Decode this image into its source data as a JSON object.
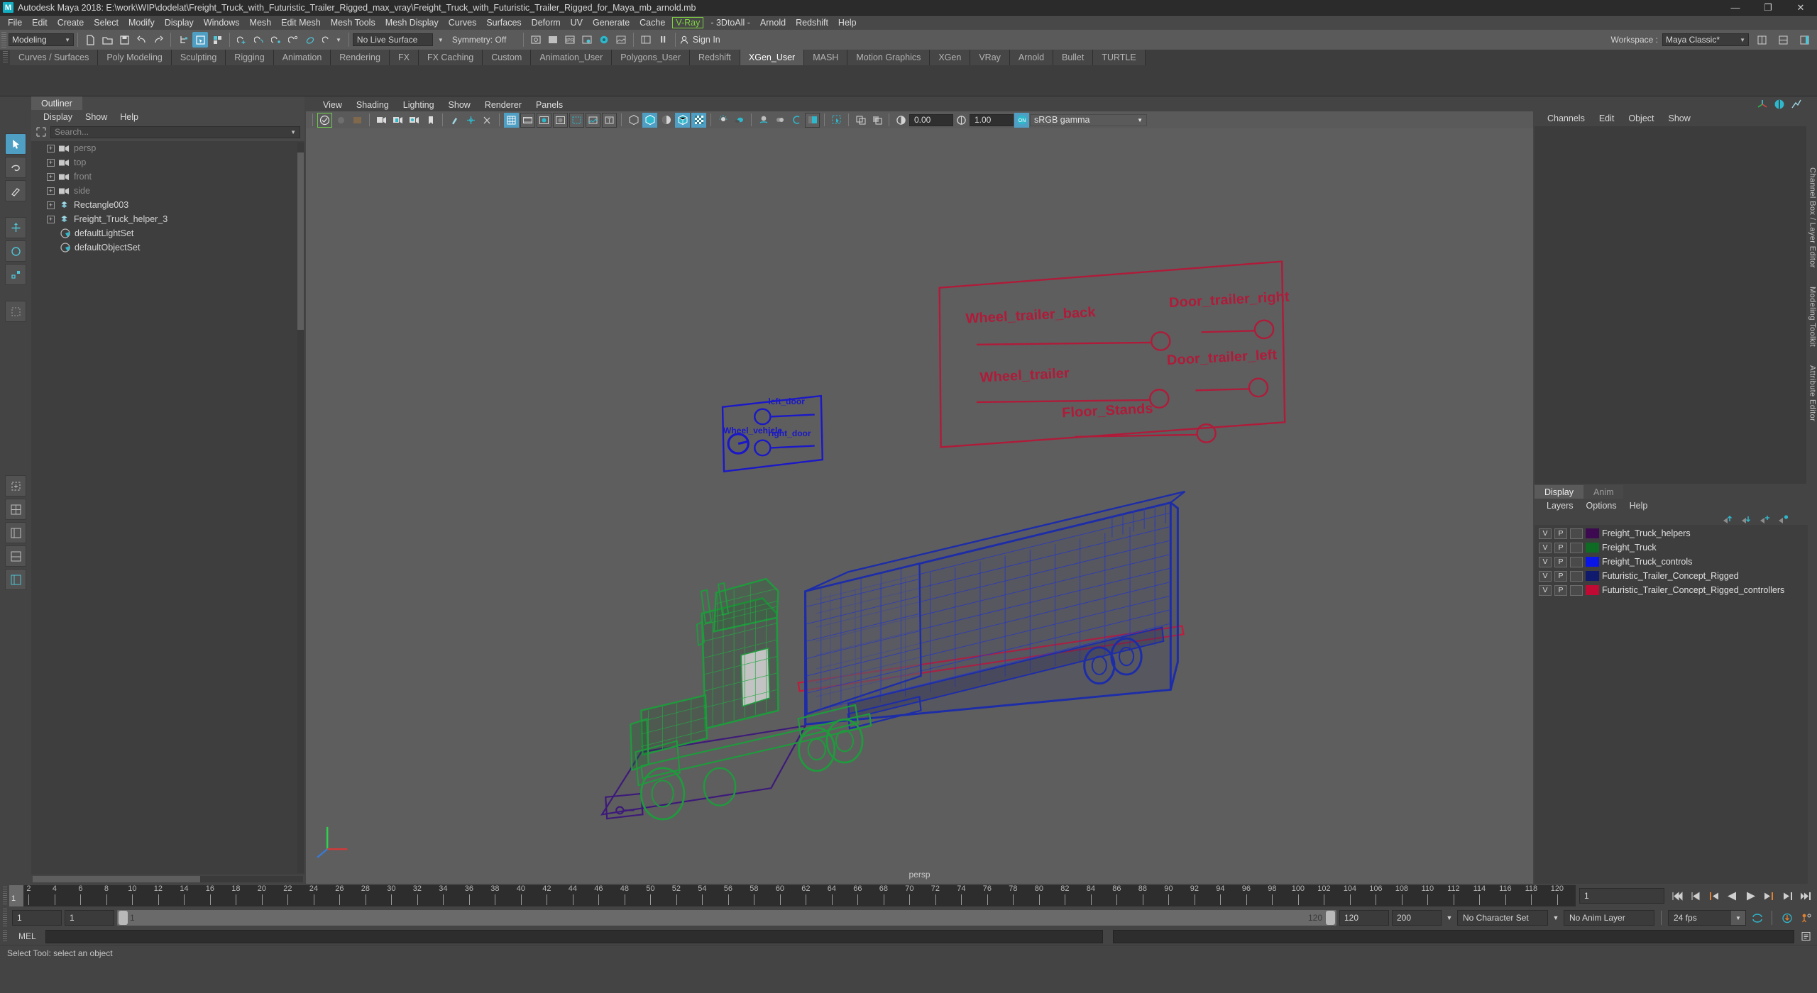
{
  "window": {
    "app_title": "Autodesk Maya 2018: E:\\work\\WIP\\dodelat\\Freight_Truck_with_Futuristic_Trailer_Rigged_max_vray\\Freight_Truck_with_Futuristic_Trailer_Rigged_for_Maya_mb_arnold.mb",
    "minimize": "—",
    "maximize": "❐",
    "close": "✕"
  },
  "menubar": [
    "File",
    "Edit",
    "Create",
    "Select",
    "Modify",
    "Display",
    "Windows",
    "Mesh",
    "Edit Mesh",
    "Mesh Tools",
    "Mesh Display",
    "Curves",
    "Surfaces",
    "Deform",
    "UV",
    "Generate",
    "Cache",
    "V-Ray",
    "- 3DtoAll -",
    "Arnold",
    "Redshift",
    "Help"
  ],
  "statusline": {
    "menu_set": "Modeling",
    "live_surface": "No Live Surface",
    "symmetry": "Symmetry: Off",
    "signin": "Sign In",
    "workspace_label": "Workspace :",
    "workspace_value": "Maya Classic*"
  },
  "shelf_tabs": [
    {
      "label": "Curves / Surfaces",
      "active": false
    },
    {
      "label": "Poly Modeling",
      "active": false
    },
    {
      "label": "Sculpting",
      "active": false
    },
    {
      "label": "Rigging",
      "active": false
    },
    {
      "label": "Animation",
      "active": false
    },
    {
      "label": "Rendering",
      "active": false
    },
    {
      "label": "FX",
      "active": false
    },
    {
      "label": "FX Caching",
      "active": false
    },
    {
      "label": "Custom",
      "active": false
    },
    {
      "label": "Animation_User",
      "active": false
    },
    {
      "label": "Polygons_User",
      "active": false
    },
    {
      "label": "Redshift",
      "active": false
    },
    {
      "label": "XGen_User",
      "active": true
    },
    {
      "label": "MASH",
      "active": false
    },
    {
      "label": "Motion Graphics",
      "active": false
    },
    {
      "label": "XGen",
      "active": false
    },
    {
      "label": "VRay",
      "active": false
    },
    {
      "label": "Arnold",
      "active": false
    },
    {
      "label": "Bullet",
      "active": false
    },
    {
      "label": "TURTLE",
      "active": false
    }
  ],
  "outliner": {
    "tab_label": "Outliner",
    "menu": [
      "Display",
      "Show",
      "Help"
    ],
    "search_placeholder": "Search...",
    "items": [
      {
        "label": "persp",
        "icon": "camera-icon",
        "dim": true,
        "expandable": true
      },
      {
        "label": "top",
        "icon": "camera-icon",
        "dim": true,
        "expandable": true
      },
      {
        "label": "front",
        "icon": "camera-icon",
        "dim": true,
        "expandable": true
      },
      {
        "label": "side",
        "icon": "camera-icon",
        "dim": true,
        "expandable": true
      },
      {
        "label": "Rectangle003",
        "icon": "transform-icon",
        "dim": false,
        "expandable": true
      },
      {
        "label": "Freight_Truck_helper_3",
        "icon": "transform-icon",
        "dim": false,
        "expandable": true
      },
      {
        "label": "defaultLightSet",
        "icon": "set-icon",
        "dim": false,
        "expandable": false
      },
      {
        "label": "defaultObjectSet",
        "icon": "set-icon",
        "dim": false,
        "expandable": false
      }
    ]
  },
  "viewport": {
    "menu": [
      "View",
      "Shading",
      "Lighting",
      "Show",
      "Renderer",
      "Panels"
    ],
    "exposure": "0.00",
    "gamma_value": "1.00",
    "color_management": "sRGB gamma",
    "camera_label": "persp",
    "annotations_red": [
      "Wheel_trailer_back",
      "Door_trailer_right",
      "Wheel_trailer",
      "Door_trailer_left",
      "Floor_Stands"
    ],
    "annotations_blue": [
      "Wheel_vehicle",
      "left_door",
      "right_door"
    ]
  },
  "channelbox": {
    "menu": [
      "Channels",
      "Edit",
      "Object",
      "Show"
    ],
    "side_tabs": [
      "Channel Box / Layer Editor",
      "Modeling Toolkit",
      "Attribute Editor"
    ]
  },
  "layer_editor": {
    "tabs": [
      {
        "label": "Display",
        "active": true
      },
      {
        "label": "Anim",
        "active": false
      }
    ],
    "menu": [
      "Layers",
      "Options",
      "Help"
    ],
    "layers": [
      {
        "v": "V",
        "p": "P",
        "color": "#3d0a52",
        "name": "Freight_Truck_helpers"
      },
      {
        "v": "V",
        "p": "P",
        "color": "#0d6b23",
        "name": "Freight_Truck"
      },
      {
        "v": "V",
        "p": "P",
        "color": "#0a16e8",
        "name": "Freight_Truck_controls"
      },
      {
        "v": "V",
        "p": "P",
        "color": "#101b6e",
        "name": "Futuristic_Trailer_Concept_Rigged"
      },
      {
        "v": "V",
        "p": "P",
        "color": "#c10a33",
        "name": "Futuristic_Trailer_Concept_Rigged_controllers"
      }
    ]
  },
  "timeline": {
    "start": 1,
    "end": 120,
    "ticks": [
      2,
      4,
      6,
      8,
      10,
      12,
      14,
      16,
      18,
      20,
      22,
      24,
      26,
      28,
      30,
      32,
      34,
      36,
      38,
      40,
      42,
      44,
      46,
      48,
      50,
      52,
      54,
      56,
      58,
      60,
      62,
      64,
      66,
      68,
      70,
      72,
      74,
      76,
      78,
      80,
      82,
      84,
      86,
      88,
      90,
      92,
      94,
      96,
      98,
      100,
      102,
      104,
      106,
      108,
      110,
      112,
      114,
      116,
      118,
      120
    ],
    "current_frame": "1",
    "current_frame_field": "1"
  },
  "range": {
    "anim_start": "1",
    "range_start": "1",
    "slider_min_label": "1",
    "slider_max_label": "120",
    "range_end": "120",
    "anim_end": "200",
    "character_set": "No Character Set",
    "anim_layer": "No Anim Layer",
    "fps": "24 fps"
  },
  "command_line": {
    "language": "MEL",
    "input_value": "",
    "result_value": ""
  },
  "help_line": {
    "text": "Select Tool: select an object"
  },
  "colors": {
    "accent": "#4f9fc4",
    "vray_green": "#7dd23f",
    "viewport_bg": "#5e5e5e",
    "truck_green": "#1f9a3d",
    "trailer_blue": "#1a2a9e",
    "controls_red": "#b01b3a",
    "helpers_purple": "#3d1a7a"
  }
}
